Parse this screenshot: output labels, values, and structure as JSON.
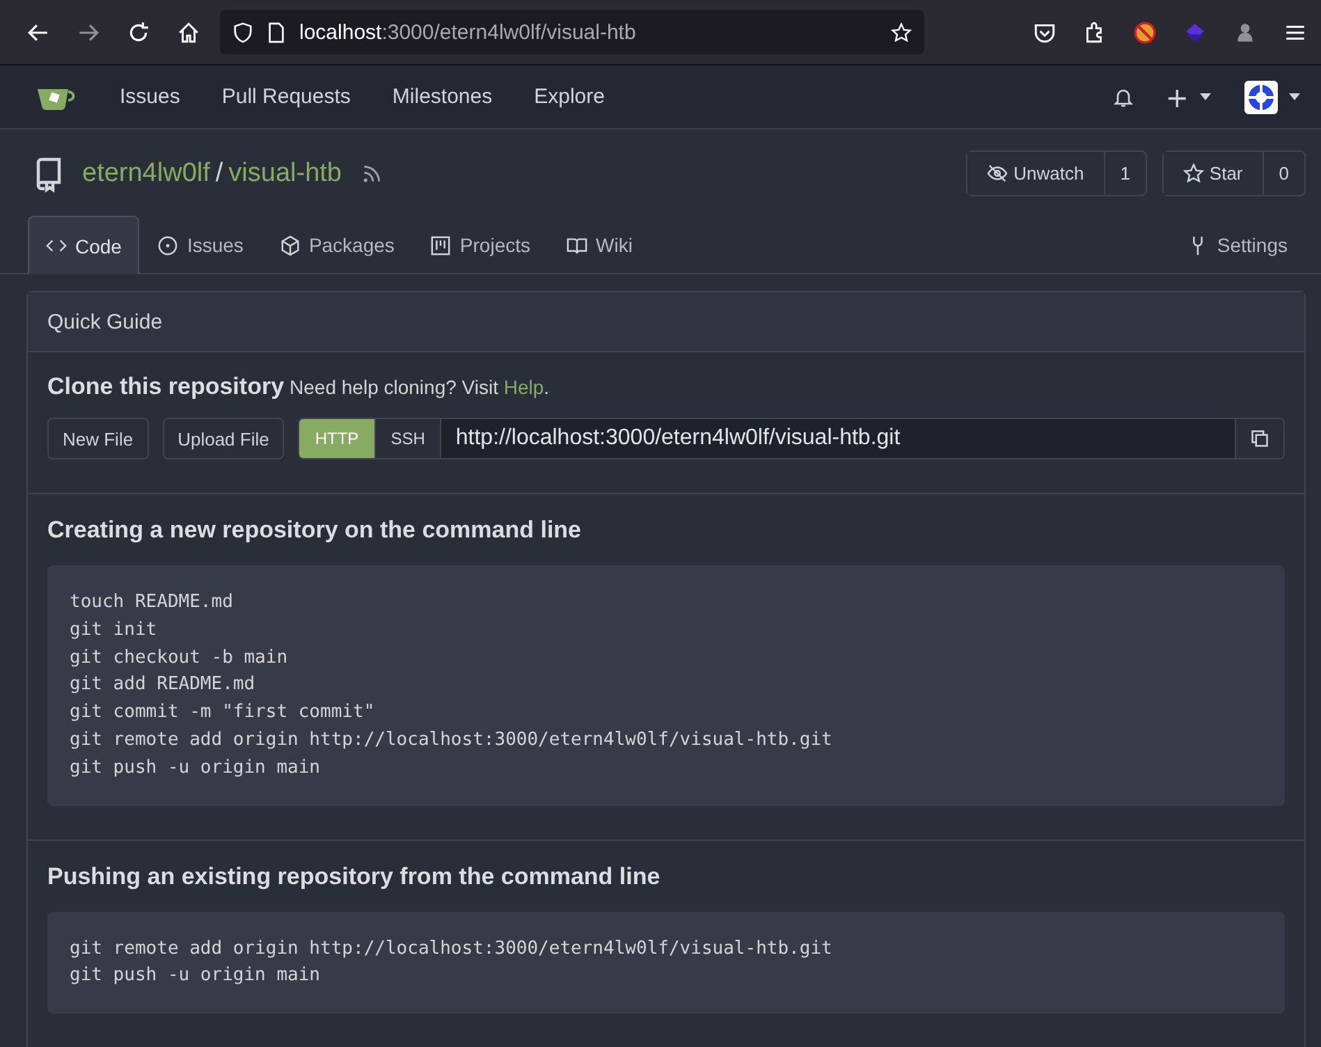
{
  "browser": {
    "url_host": "localhost",
    "url_path": ":3000/etern4lw0lf/visual-htb"
  },
  "navbar": {
    "items": [
      "Issues",
      "Pull Requests",
      "Milestones",
      "Explore"
    ],
    "plus_label": "+"
  },
  "repo": {
    "owner": "etern4lw0lf",
    "separator": "/",
    "name": "visual-htb",
    "actions": [
      {
        "kind": "watch",
        "label": "Unwatch",
        "count": "1"
      },
      {
        "kind": "star",
        "label": "Star",
        "count": "0"
      }
    ]
  },
  "tabs": [
    {
      "kind": "code",
      "label": "Code",
      "selected": true
    },
    {
      "kind": "issues",
      "label": "Issues",
      "selected": false
    },
    {
      "kind": "packages",
      "label": "Packages",
      "selected": false
    },
    {
      "kind": "projects",
      "label": "Projects",
      "selected": false
    },
    {
      "kind": "wiki",
      "label": "Wiki",
      "selected": false
    }
  ],
  "settings_tab": {
    "label": "Settings"
  },
  "guide": {
    "title": "Quick Guide",
    "clone": {
      "heading": "Clone this repository",
      "help_text": "Need help cloning? Visit",
      "help_link": "Help",
      "help_end": ".",
      "buttons": [
        "New File",
        "Upload File"
      ],
      "protocols": [
        {
          "label": "HTTP",
          "selected": true
        },
        {
          "label": "SSH",
          "selected": false
        }
      ],
      "url": "http://localhost:3000/etern4lw0lf/visual-htb.git"
    },
    "sections": [
      {
        "title": "Creating a new repository on the command line",
        "code": [
          "touch README.md",
          "git init",
          "git checkout -b main",
          "git add README.md",
          "git commit -m \"first commit\"",
          "git remote add origin http://localhost:3000/etern4lw0lf/visual-htb.git",
          "git push -u origin main"
        ]
      },
      {
        "title": "Pushing an existing repository from the command line",
        "code": [
          "git remote add origin http://localhost:3000/etern4lw0lf/visual-htb.git",
          "git push -u origin main"
        ]
      }
    ]
  }
}
